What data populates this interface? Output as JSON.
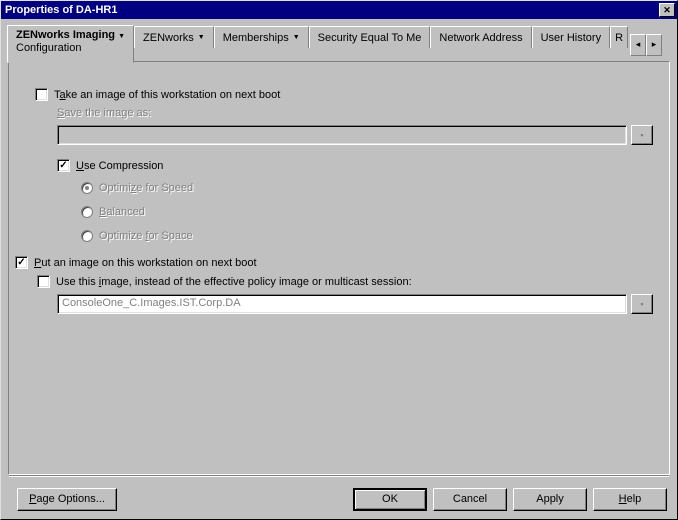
{
  "window": {
    "title": "Properties of DA-HR1"
  },
  "tabs": {
    "active": {
      "label": "ZENworks Imaging",
      "sub": "Configuration"
    },
    "others": [
      "ZENworks",
      "Memberships",
      "Security Equal To Me",
      "Network Address",
      "User History",
      "R"
    ]
  },
  "form": {
    "take_image": {
      "checked": false,
      "label_pre": "T",
      "label_mn": "a",
      "label_post": "ke an image of this workstation on next boot"
    },
    "save_as": {
      "label_pre": "",
      "label_mn": "S",
      "label_post": "ave the image as:",
      "value": ""
    },
    "use_compression": {
      "checked": true,
      "label_pre": "",
      "label_mn": "U",
      "label_post": "se Compression"
    },
    "opt_speed": {
      "selected": true,
      "label_pre": "Optimi",
      "label_mn": "z",
      "label_post": "e for Speed"
    },
    "opt_balanced": {
      "selected": false,
      "label_pre": "",
      "label_mn": "B",
      "label_post": "alanced"
    },
    "opt_space": {
      "selected": false,
      "label_pre": "Optimize ",
      "label_mn": "f",
      "label_post": "or Space"
    },
    "put_image": {
      "checked": true,
      "label_pre": "",
      "label_mn": "P",
      "label_post": "ut an image on this workstation on next boot"
    },
    "use_this_image": {
      "checked": false,
      "label_pre": "Use this ",
      "label_mn": "i",
      "label_post": "mage, instead of the effective policy image or multicast session:"
    },
    "image_path": {
      "value": "ConsoleOne_C.Images.IST.Corp.DA"
    }
  },
  "buttons": {
    "page_options_pre": "",
    "page_options_mn": "P",
    "page_options_post": "age Options...",
    "ok": "OK",
    "cancel": "Cancel",
    "apply": "Apply",
    "help_pre": "",
    "help_mn": "H",
    "help_post": "elp"
  }
}
